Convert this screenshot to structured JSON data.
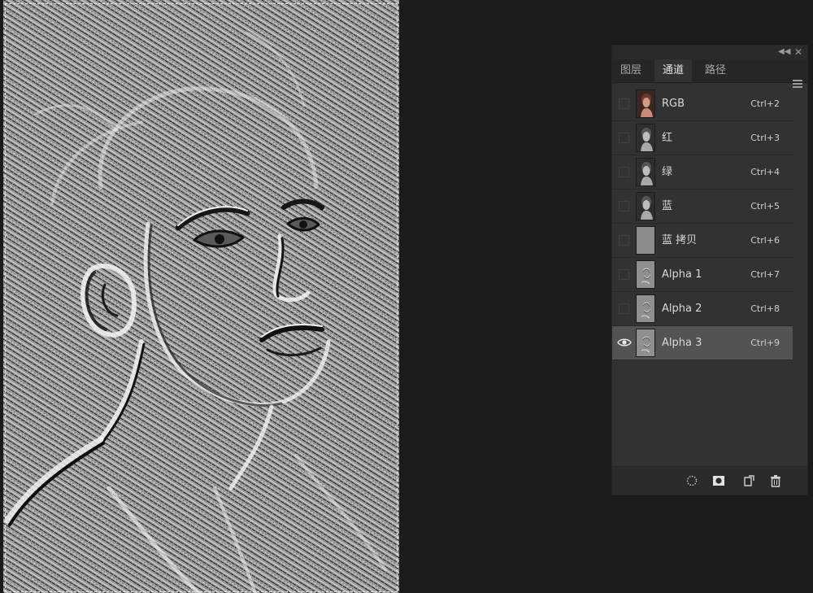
{
  "panel": {
    "tabs": [
      {
        "label": "图层",
        "active": false
      },
      {
        "label": "通道",
        "active": true
      },
      {
        "label": "路径",
        "active": false
      }
    ],
    "collapse_icon": "double-chevron-left-icon",
    "close_icon": "close-icon",
    "menu_icon": "hamburger-menu-icon",
    "channels": [
      {
        "name": "RGB",
        "shortcut": "Ctrl+2",
        "visible": false,
        "selected": false,
        "thumb": "color"
      },
      {
        "name": "红",
        "shortcut": "Ctrl+3",
        "visible": false,
        "selected": false,
        "thumb": "gray"
      },
      {
        "name": "绿",
        "shortcut": "Ctrl+4",
        "visible": false,
        "selected": false,
        "thumb": "gray"
      },
      {
        "name": "蓝",
        "shortcut": "Ctrl+5",
        "visible": false,
        "selected": false,
        "thumb": "gray"
      },
      {
        "name": "蓝 拷贝",
        "shortcut": "Ctrl+6",
        "visible": false,
        "selected": false,
        "thumb": "flat"
      },
      {
        "name": "Alpha 1",
        "shortcut": "Ctrl+7",
        "visible": false,
        "selected": false,
        "thumb": "alpha"
      },
      {
        "name": "Alpha 2",
        "shortcut": "Ctrl+8",
        "visible": false,
        "selected": false,
        "thumb": "alpha"
      },
      {
        "name": "Alpha 3",
        "shortcut": "Ctrl+9",
        "visible": true,
        "selected": true,
        "thumb": "alpha"
      }
    ],
    "footer_buttons": [
      {
        "name": "load-selection-button",
        "icon": "dotted-circle-icon"
      },
      {
        "name": "save-selection-as-channel-button",
        "icon": "mask-icon"
      },
      {
        "name": "new-channel-button",
        "icon": "new-page-icon"
      },
      {
        "name": "delete-channel-button",
        "icon": "trash-icon"
      }
    ]
  },
  "colors": {
    "app_bg": "#1b1b1b",
    "panel_bg": "#323232",
    "selected_row": "#535353",
    "canvas_gray": "#8e8e8e"
  }
}
